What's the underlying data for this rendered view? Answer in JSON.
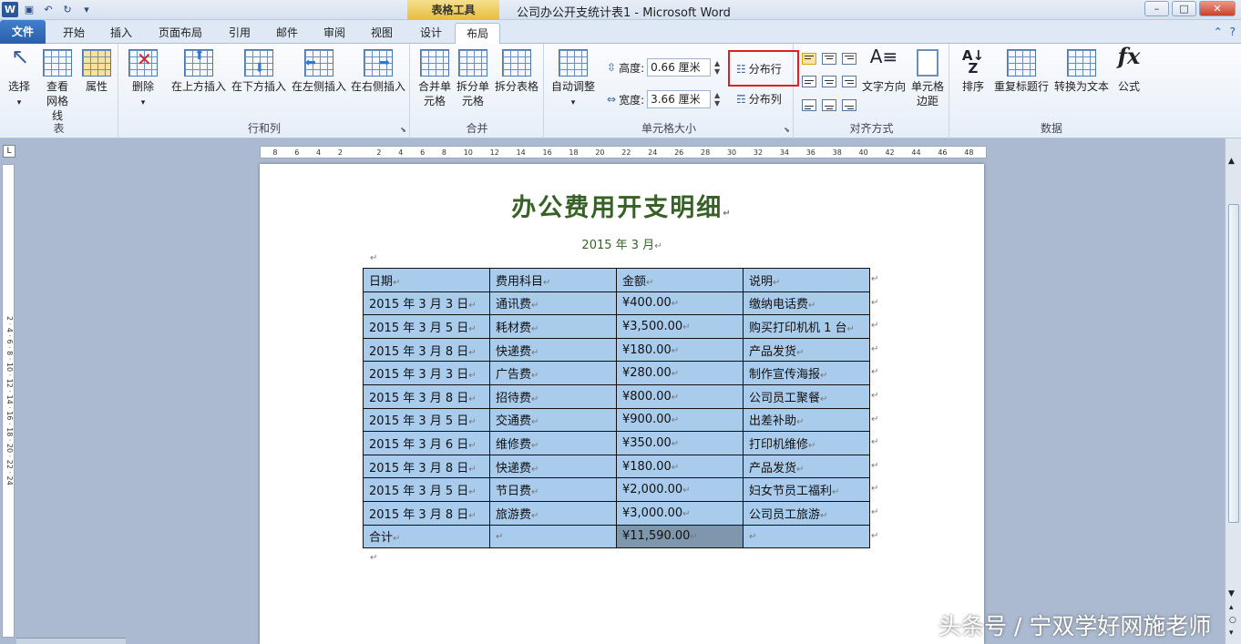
{
  "window": {
    "title": "公司办公开支统计表1 - Microsoft Word",
    "context_tab": "表格工具",
    "controls": [
      "–",
      "□",
      "✕"
    ]
  },
  "tabs": [
    "文件",
    "开始",
    "插入",
    "页面布局",
    "引用",
    "邮件",
    "审阅",
    "视图",
    "设计",
    "布局"
  ],
  "active_tab": "布局",
  "ribbon": {
    "group_table": {
      "label": "表",
      "select": "选择",
      "gridlines": "查看网格线",
      "properties": "属性"
    },
    "group_rowcol": {
      "label": "行和列",
      "delete": "删除",
      "insert_above": "在上方插入",
      "insert_below": "在下方插入",
      "insert_left": "在左侧插入",
      "insert_right": "在右侧插入"
    },
    "group_merge": {
      "label": "合并",
      "merge_cells": "合并单元格",
      "split_cells": "拆分单元格",
      "split_table": "拆分表格"
    },
    "group_cellsize": {
      "label": "单元格大小",
      "autofit": "自动调整",
      "height_label": "高度:",
      "height_value": "0.66 厘米",
      "width_label": "宽度:",
      "width_value": "3.66 厘米",
      "distribute_rows": "分布行",
      "distribute_cols": "分布列"
    },
    "group_align": {
      "label": "对齐方式",
      "text_direction": "文字方向",
      "cell_margins": "单元格边距"
    },
    "group_data": {
      "label": "数据",
      "sort": "排序",
      "repeat_header": "重复标题行",
      "to_text": "转换为文本",
      "formula": "公式"
    }
  },
  "ruler_ticks": [
    "8",
    "6",
    "4",
    "2",
    "",
    "2",
    "4",
    "6",
    "8",
    "10",
    "12",
    "14",
    "16",
    "18",
    "20",
    "22",
    "24",
    "26",
    "28",
    "30",
    "32",
    "34",
    "36",
    "38",
    "40",
    "42",
    "44",
    "46",
    "48"
  ],
  "vruler_text": "2 · 4 · 6 · 8 · 10 · 12 · 14 · 16 · 18 · 20 · 22 · 24",
  "document": {
    "title": "办公费用开支明细",
    "date": "2015 年 3 月",
    "headers": [
      "日期",
      "费用科目",
      "金额",
      "说明"
    ],
    "rows": [
      [
        "2015 年 3 月 3 日",
        "通讯费",
        "¥400.00",
        "缴纳电话费"
      ],
      [
        "2015 年 3 月 5 日",
        "耗材费",
        "¥3,500.00",
        "购买打印机机 1 台"
      ],
      [
        "2015 年 3 月 8 日",
        "快递费",
        "¥180.00",
        "产品发货"
      ],
      [
        "2015 年 3 月 3 日",
        "广告费",
        "¥280.00",
        "制作宣传海报"
      ],
      [
        "2015 年 3 月 8 日",
        "招待费",
        "¥800.00",
        "公司员工聚餐"
      ],
      [
        "2015 年 3 月 5 日",
        "交通费",
        "¥900.00",
        "出差补助"
      ],
      [
        "2015 年 3 月 6 日",
        "维修费",
        "¥350.00",
        "打印机维修"
      ],
      [
        "2015 年 3 月 8 日",
        "快递费",
        "¥180.00",
        "产品发货"
      ],
      [
        "2015 年 3 月 5 日",
        "节日费",
        "¥2,000.00",
        "妇女节员工福利"
      ],
      [
        "2015 年 3 月 8 日",
        "旅游费",
        "¥3,000.00",
        "公司员工旅游"
      ]
    ],
    "total": [
      "合计",
      "",
      "¥11,590.00",
      ""
    ],
    "para_mark": "↵"
  },
  "watermark": "头条号 / 宁双学好网施老师",
  "colors": {
    "title_green": "#376127",
    "cell_blue": "#a9cbec",
    "highlight_box": "#e02020"
  }
}
